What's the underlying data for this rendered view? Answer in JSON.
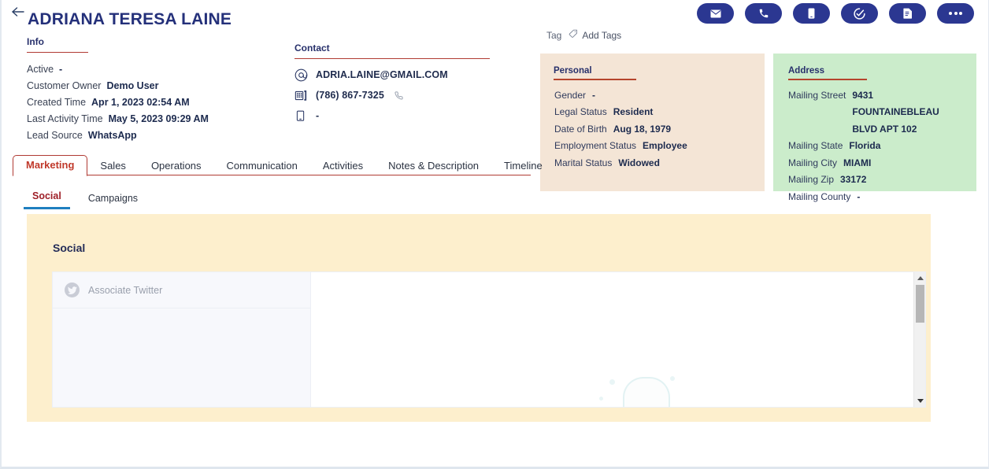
{
  "header": {
    "title": "ADRIANA TERESA LAINE",
    "back_icon": "back-arrow-icon",
    "actions": [
      {
        "name": "email-action",
        "icon": "envelope-icon"
      },
      {
        "name": "call-action",
        "icon": "phone-icon"
      },
      {
        "name": "sms-action",
        "icon": "mobile-icon"
      },
      {
        "name": "task-action",
        "icon": "check-circle-icon"
      },
      {
        "name": "document-action",
        "icon": "document-icon"
      },
      {
        "name": "more-action",
        "icon": "ellipsis-icon"
      }
    ]
  },
  "info": {
    "heading": "Info",
    "rows": [
      {
        "label": "Active",
        "value": "-"
      },
      {
        "label": "Customer Owner",
        "value": "Demo User"
      },
      {
        "label": "Created Time",
        "value": "Apr 1, 2023 02:54 AM"
      },
      {
        "label": "Last Activity Time",
        "value": "May 5, 2023 09:29 AM"
      },
      {
        "label": "Lead Source",
        "value": "WhatsApp"
      }
    ]
  },
  "contact": {
    "heading": "Contact",
    "email": "ADRIA.LAINE@GMAIL.COM",
    "phone": "(786) 867-7325",
    "mobile": "-"
  },
  "tag": {
    "label": "Tag",
    "add_label": "Add Tags"
  },
  "personal": {
    "heading": "Personal",
    "rows": [
      {
        "label": "Gender",
        "value": "-"
      },
      {
        "label": "Legal Status",
        "value": "Resident"
      },
      {
        "label": "Date of Birth",
        "value": "Aug 18, 1979"
      },
      {
        "label": "Employment Status",
        "value": "Employee"
      },
      {
        "label": "Marital Status",
        "value": "Widowed"
      }
    ]
  },
  "address": {
    "heading": "Address",
    "rows": [
      {
        "label": "Mailing Street",
        "value": "9431 FOUNTAINEBLEAU BLVD APT 102"
      },
      {
        "label": "Mailing State",
        "value": "Florida"
      },
      {
        "label": "Mailing City",
        "value": "MIAMI"
      },
      {
        "label": "Mailing Zip",
        "value": "33172"
      },
      {
        "label": "Mailing County",
        "value": "-"
      }
    ]
  },
  "tabs": {
    "items": [
      {
        "label": "Marketing",
        "active": true
      },
      {
        "label": "Sales",
        "active": false
      },
      {
        "label": "Operations",
        "active": false
      },
      {
        "label": "Communication",
        "active": false
      },
      {
        "label": "Activities",
        "active": false
      },
      {
        "label": "Notes & Description",
        "active": false
      },
      {
        "label": "Timeline",
        "active": false
      }
    ]
  },
  "subtabs": {
    "items": [
      {
        "label": "Social",
        "active": true
      },
      {
        "label": "Campaigns",
        "active": false
      }
    ]
  },
  "social": {
    "title": "Social",
    "associate_label": "Associate Twitter",
    "associate_icon": "twitter-icon"
  },
  "colors": {
    "brand_navy": "#2b3791",
    "title_navy": "#24307a",
    "accent_red": "#b03a33",
    "active_tab_red": "#c0392b",
    "subtab_red": "#9e1f28",
    "subtab_underline": "#1f7fbf",
    "panel_personal_bg": "#f4e5d6",
    "panel_address_bg": "#cbeccb",
    "social_bg": "#fdefcd"
  }
}
